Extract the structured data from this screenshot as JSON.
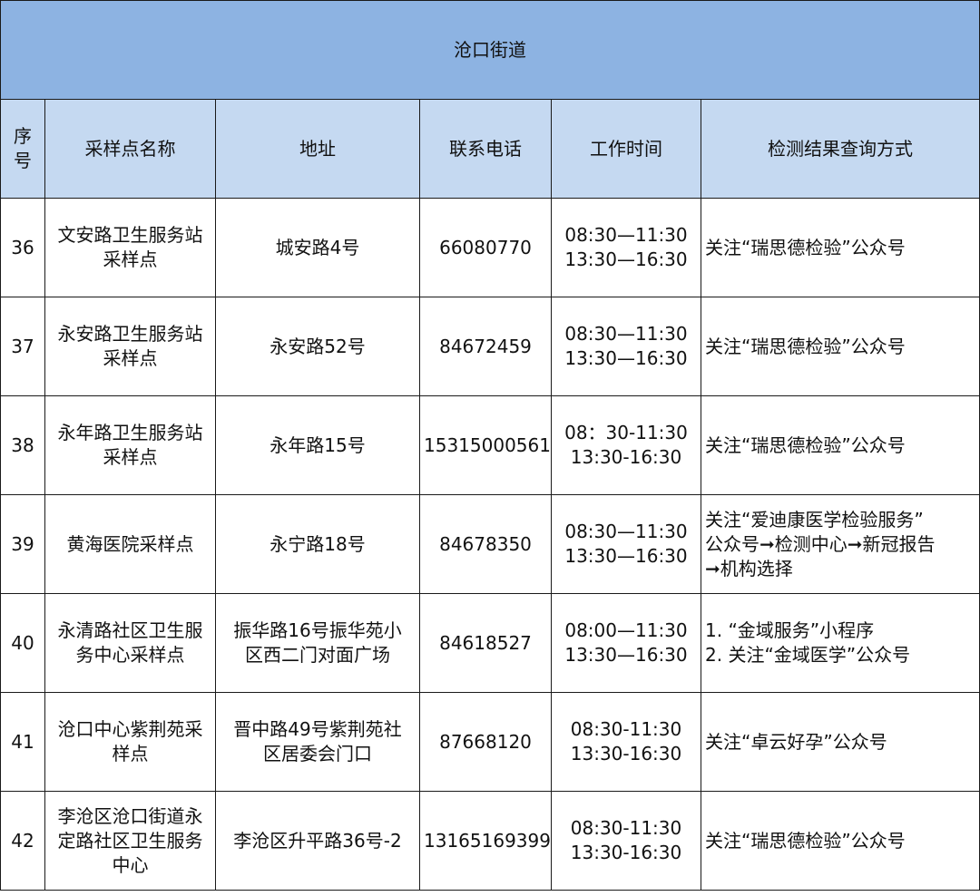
{
  "title": "沧口街道",
  "headers": {
    "index": "序\n号",
    "name": "采样点名称",
    "address": "地址",
    "phone": "联系电话",
    "hours": "工作时间",
    "query": "检测结果查询方式"
  },
  "rows": [
    {
      "index": "36",
      "name": "文安路卫生服务站\n采样点",
      "address": "城安路4号",
      "phone": "66080770",
      "hours": "08:30—11:30\n13:30—16:30",
      "query": "关注“瑞思德检验”公众号"
    },
    {
      "index": "37",
      "name": "永安路卫生服务站\n采样点",
      "address": "永安路52号",
      "phone": "84672459",
      "hours": "08:30—11:30\n13:30—16:30",
      "query": "关注“瑞思德检验”公众号"
    },
    {
      "index": "38",
      "name": "永年路卫生服务站\n采样点",
      "address": "永年路15号",
      "phone": "15315000561",
      "hours": "08：30-11:30\n13:30-16:30",
      "query": "关注“瑞思德检验”公众号"
    },
    {
      "index": "39",
      "name": "黄海医院采样点",
      "address": "永宁路18号",
      "phone": "84678350",
      "hours": "08:30—11:30\n13:30—16:30",
      "query": "关注“爱迪康医学检验服务”\n公众号➞检测中心➞新冠报告\n➞机构选择"
    },
    {
      "index": "40",
      "name": "永清路社区卫生服\n务中心采样点",
      "address": "振华路16号振华苑小\n区西二门对面广场",
      "phone": "84618527",
      "hours": "08:00—11:30\n13:30—16:30",
      "query": "1. “金域服务”小程序\n2. 关注“金域医学”公众号"
    },
    {
      "index": "41",
      "name": "沧口中心紫荆苑采\n样点",
      "address": "晋中路49号紫荆苑社\n区居委会门口",
      "phone": "87668120",
      "hours": "08:30-11:30\n13:30-16:30",
      "query": "关注“卓云好孕”公众号"
    },
    {
      "index": "42",
      "name": "李沧区沧口街道永\n定路社区卫生服务\n中心",
      "address": "李沧区升平路36号-2",
      "phone": "13165169399",
      "hours": "08:30-11:30\n13:30-16:30",
      "query": "关注“瑞思德检验”公众号"
    }
  ]
}
